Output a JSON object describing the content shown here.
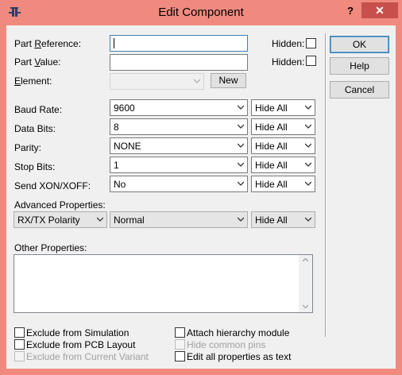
{
  "window": {
    "title": "Edit Component",
    "help_symbol": "?",
    "close_symbol": "✕"
  },
  "fields": {
    "part_reference": {
      "label_pre": "Part ",
      "label_u": "R",
      "label_post": "eference:",
      "value": "",
      "hidden_label": "Hidden:"
    },
    "part_value": {
      "label_pre": "Part ",
      "label_u": "V",
      "label_post": "alue:",
      "value": "",
      "hidden_label": "Hidden:"
    },
    "element": {
      "label_pre": "",
      "label_u": "E",
      "label_post": "lement:",
      "value": "",
      "new_button": "New"
    }
  },
  "properties": [
    {
      "label": "Baud Rate:",
      "value": "9600",
      "visibility": "Hide All"
    },
    {
      "label": "Data Bits:",
      "value": "8",
      "visibility": "Hide All"
    },
    {
      "label": "Parity:",
      "value": "NONE",
      "visibility": "Hide All"
    },
    {
      "label": "Stop Bits:",
      "value": "1",
      "visibility": "Hide All"
    },
    {
      "label": "Send XON/XOFF:",
      "value": "No",
      "visibility": "Hide All"
    }
  ],
  "advanced": {
    "label": "Advanced Properties:",
    "property": "RX/TX Polarity",
    "value": "Normal",
    "visibility": "Hide All"
  },
  "other": {
    "label": "Other Properties:",
    "value": ""
  },
  "options": {
    "exclude_simulation": "Exclude from Simulation",
    "exclude_pcb": "Exclude from PCB Layout",
    "exclude_variant": "Exclude from Current Variant",
    "attach_hierarchy": "Attach hierarchy module",
    "hide_common_pins": "Hide common pins",
    "edit_all_text": "Edit all properties as text"
  },
  "buttons": {
    "ok": "OK",
    "help": "Help",
    "cancel": "Cancel"
  },
  "colors": {
    "title_bar": "#f08a7e",
    "close": "#c7504a",
    "panel": "#f0f0f0",
    "focus": "#3c7fb1"
  }
}
